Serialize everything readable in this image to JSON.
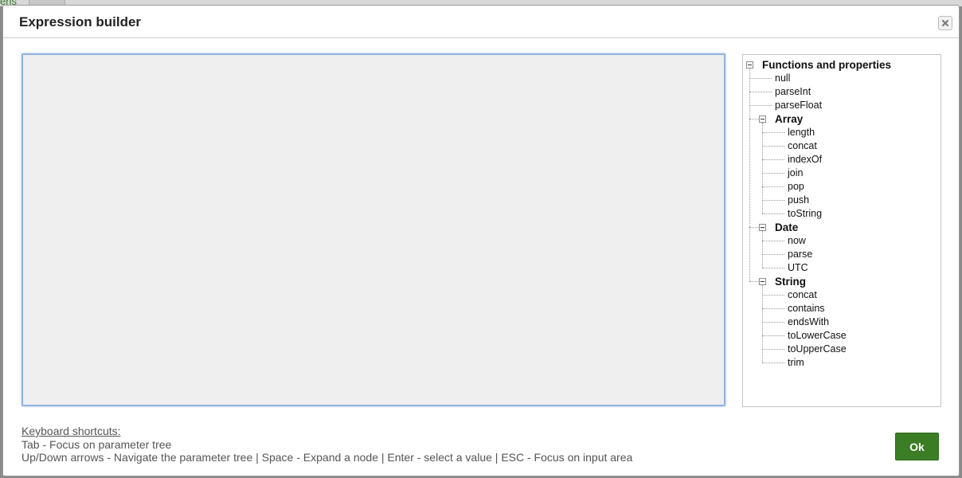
{
  "background": {
    "fragment_text": "ens"
  },
  "dialog": {
    "title": "Expression builder",
    "close_icon": "close-icon",
    "input_value": "",
    "tree": {
      "root_label": "Functions and properties",
      "top_items": [
        "null",
        "parseInt",
        "parseFloat"
      ],
      "groups": [
        {
          "label": "Array",
          "items": [
            "length",
            "concat",
            "indexOf",
            "join",
            "pop",
            "push",
            "toString"
          ]
        },
        {
          "label": "Date",
          "items": [
            "now",
            "parse",
            "UTC"
          ]
        },
        {
          "label": "String",
          "items": [
            "concat",
            "contains",
            "endsWith",
            "toLowerCase",
            "toUpperCase",
            "trim"
          ]
        }
      ]
    },
    "shortcuts": {
      "heading": "Keyboard shortcuts:",
      "line1": "Tab - Focus on parameter tree",
      "line2": "Up/Down arrows - Navigate the parameter tree | Space - Expand a node | Enter - select a value | ESC - Focus on input area"
    },
    "ok_label": "Ok",
    "colors": {
      "ok_button": "#3a7d24",
      "input_border": "#8fb3de",
      "input_bg": "#efefef"
    }
  }
}
